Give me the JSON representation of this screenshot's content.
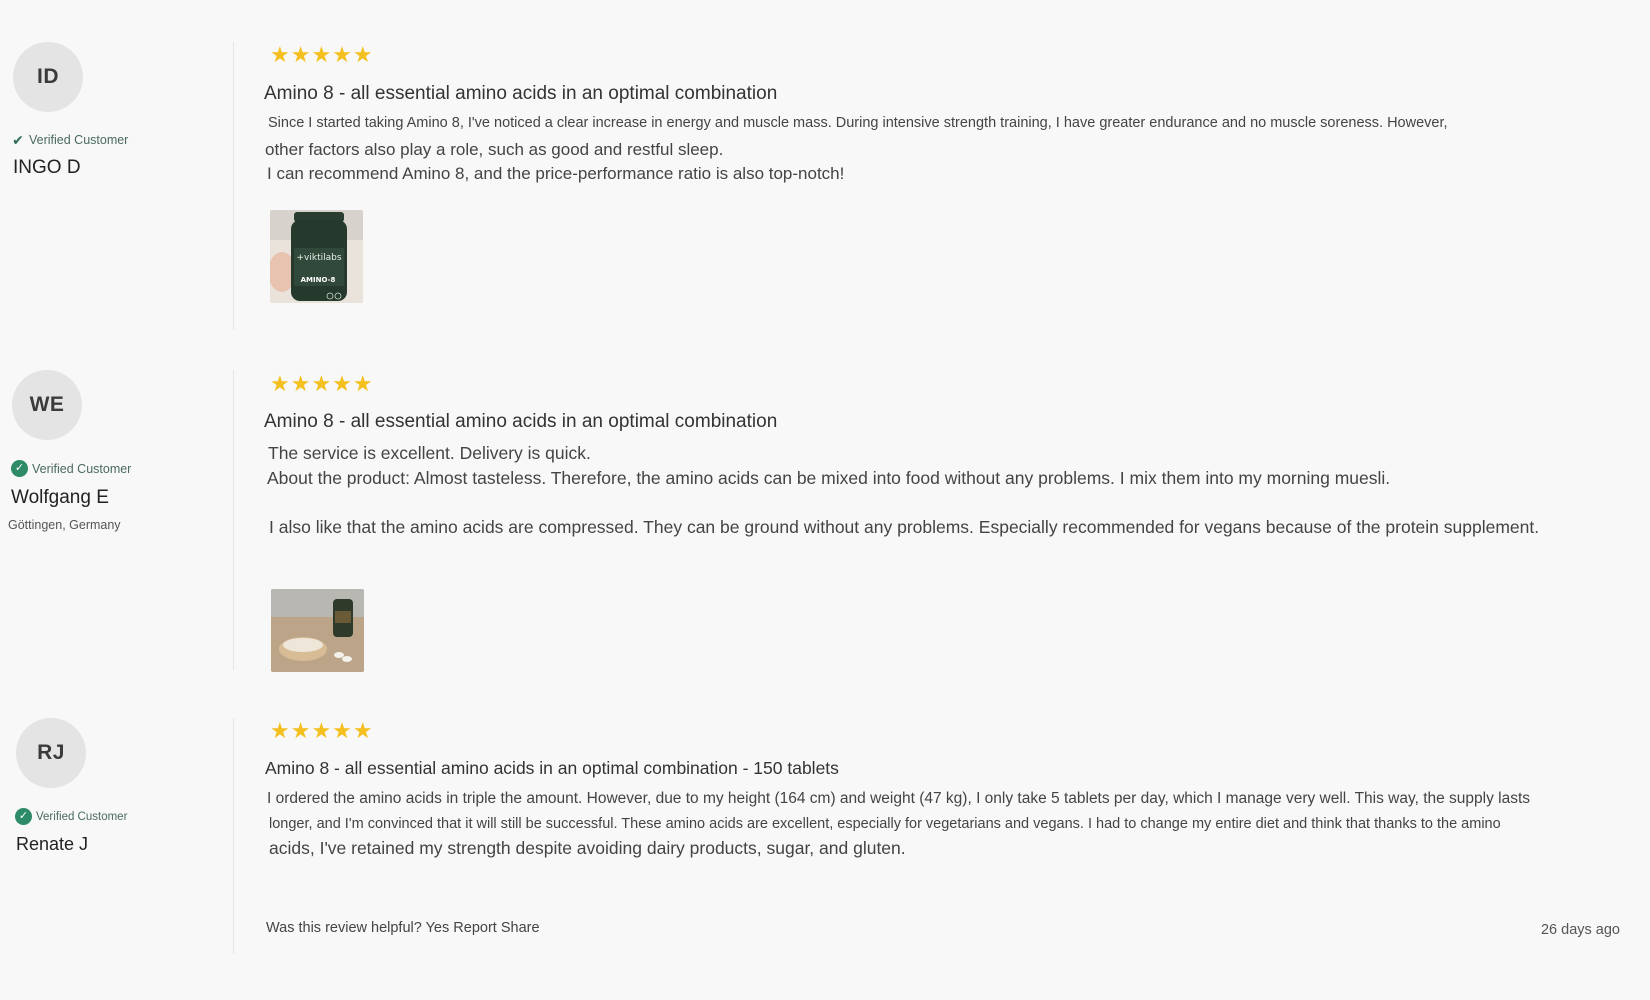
{
  "reviews": [
    {
      "initials": "ID",
      "verified_label": "Verified Customer",
      "name": "INGO D",
      "rating": 5,
      "stars_text": "★★★★★",
      "title": "Amino 8 - all essential amino acids in an optimal combination",
      "body": [
        "Since I started taking Amino 8, I've noticed a clear increase in energy and muscle mass. During intensive strength training, I have greater endurance and no muscle soreness. However,",
        "other factors also play a role, such as good and restful sleep.",
        "I can recommend Amino 8, and the price-performance ratio is also top-notch!"
      ],
      "image_alt": "Amino-8 bottle held in hand",
      "image_label_brand": "+viktilabs",
      "image_label_product": "AMINO-8"
    },
    {
      "initials": "WE",
      "verified_label": "Verified Customer",
      "name": "Wolfgang E",
      "location": "Göttingen, Germany",
      "rating": 5,
      "stars_text": "★★★★★",
      "title": "Amino 8 - all essential amino acids in an optimal combination",
      "body": [
        "The service is excellent. Delivery is quick.",
        "About the product: Almost tasteless. Therefore, the amino acids can be mixed into food without any problems. I mix them into my morning muesli.",
        "I also like that the amino acids are compressed. They can be ground without any problems. Especially recommended for vegans because of the protein supplement."
      ],
      "image_alt": "Mortar with ground tablets and bottle"
    },
    {
      "initials": "RJ",
      "verified_label": "Verified Customer",
      "name": "Renate J",
      "rating": 5,
      "stars_text": "★★★★★",
      "title": "Amino 8 - all essential amino acids in an optimal combination - 150 tablets",
      "body": [
        "I ordered the amino acids in triple the amount. However, due to my height (164 cm) and weight (47 kg), I only take 5 tablets per day, which I manage very well. This way, the supply lasts",
        "longer, and I'm convinced that it will still be successful. These amino acids are excellent, especially for vegetarians and vegans. I had to change my entire diet and think that thanks to the amino",
        "acids, I've retained my strength despite avoiding dairy products, sugar, and gluten."
      ],
      "footer": {
        "helpful_label": "Was this review helpful?",
        "yes_label": "Yes",
        "report_label": "Report",
        "share_label": "Share"
      },
      "date": "26 days ago"
    }
  ],
  "colors": {
    "star": "#f4c020",
    "verified_badge": "#2e8b68",
    "background": "#f8f8f8"
  }
}
